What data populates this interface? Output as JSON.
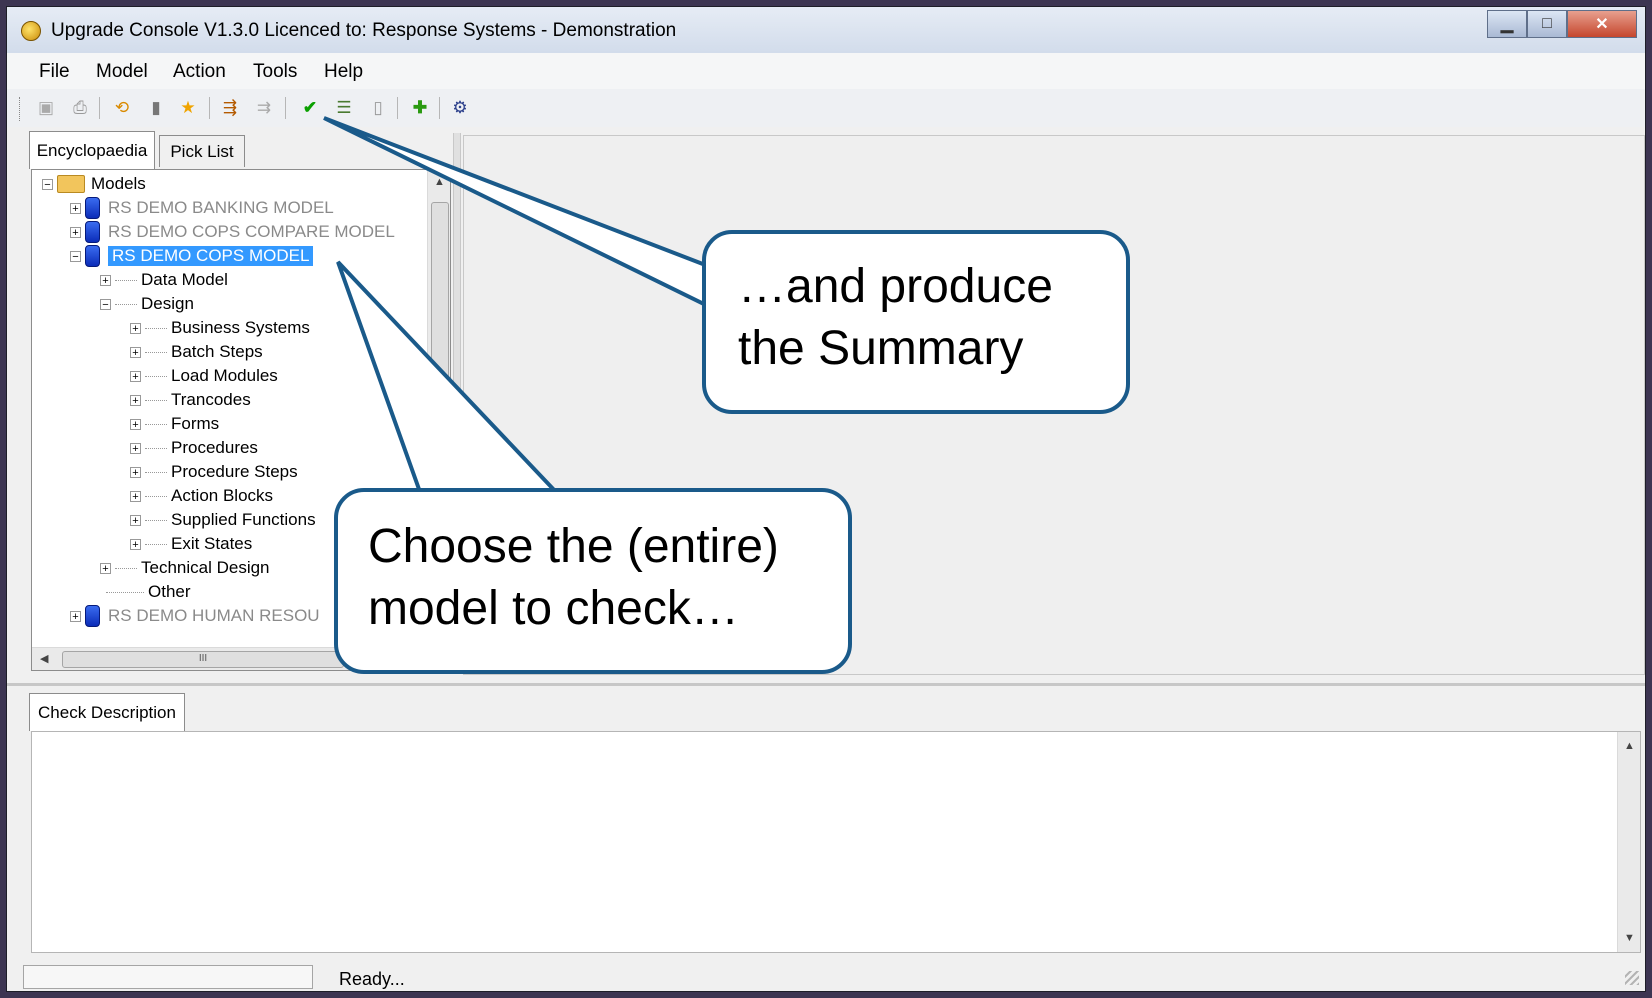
{
  "window": {
    "title": "Upgrade Console V1.3.0 Licenced to: Response Systems - Demonstration"
  },
  "menu": [
    "File",
    "Model",
    "Action",
    "Tools",
    "Help"
  ],
  "toolbar_icons": [
    "save-icon",
    "print-icon",
    "refresh-icon",
    "database-icon",
    "star-icon",
    "transfer-icon",
    "transfer-disabled-icon",
    "check-icon",
    "list-icon",
    "page-icon",
    "add-icon",
    "settings-icon"
  ],
  "left_tabs": [
    "Encyclopaedia",
    "Pick List"
  ],
  "tree": {
    "root": "Models",
    "items": [
      "RS DEMO BANKING MODEL",
      "RS DEMO COPS COMPARE MODEL",
      "RS DEMO COPS MODEL",
      "Data Model",
      "Design",
      "Business Systems",
      "Batch Steps",
      "Load Modules",
      "Trancodes",
      "Forms",
      "Procedures",
      "Procedure Steps",
      "Action Blocks",
      "Supplied Functions",
      "Exit States",
      "Technical Design",
      "Other",
      "RS DEMO HUMAN RESOU"
    ],
    "hscroll_grip": "III"
  },
  "bottom_tab": "Check Description",
  "status": {
    "text": "Ready..."
  },
  "callouts": {
    "summary": [
      "…and produce",
      "the Summary"
    ],
    "choose": [
      "Choose the (entire)",
      "model to check…"
    ]
  },
  "colors": {
    "callout_border": "#1a5a8a",
    "selection": "#3399ff"
  }
}
